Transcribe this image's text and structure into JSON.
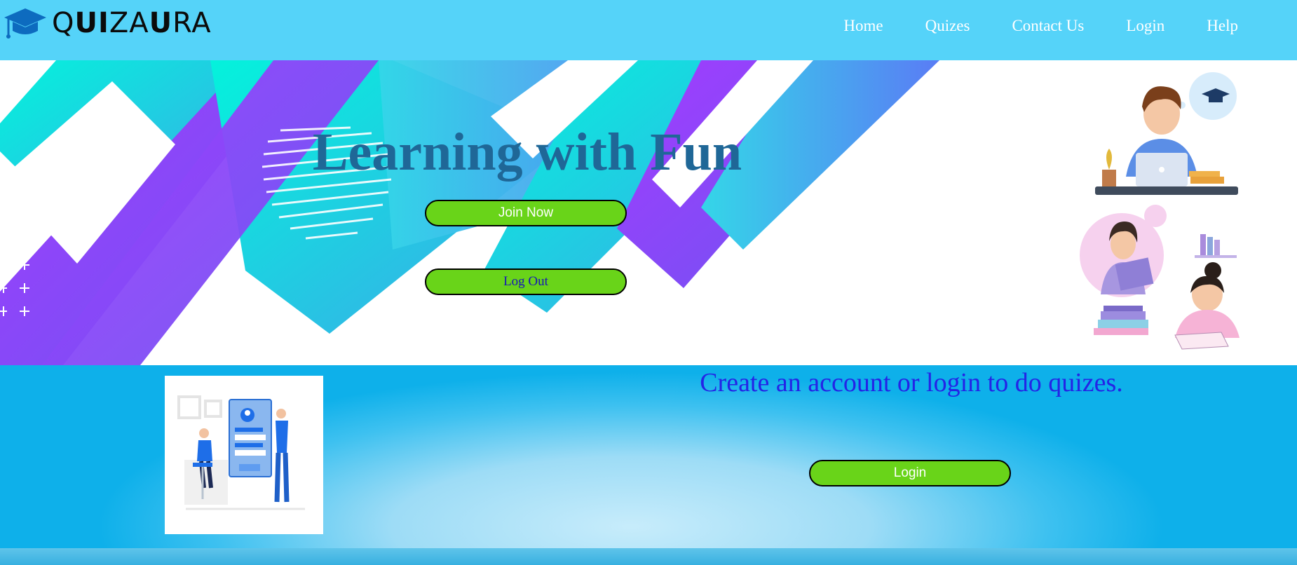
{
  "brand": {
    "logo_icon": "graduation-cap-icon",
    "name_parts": [
      "Q",
      "UI",
      "ZA",
      "U",
      "RA"
    ],
    "accent": "#55d3f9"
  },
  "nav": {
    "items": [
      {
        "label": "Home"
      },
      {
        "label": "Quizes"
      },
      {
        "label": "Contact Us"
      },
      {
        "label": "Login"
      },
      {
        "label": "Help"
      }
    ]
  },
  "hero": {
    "title": "Learning with Fun",
    "join_label": "Join Now",
    "logout_label": "Log Out",
    "button_color": "#69d419"
  },
  "account": {
    "prompt": "Create an account or login to do quizes.",
    "login_label": "Login"
  }
}
